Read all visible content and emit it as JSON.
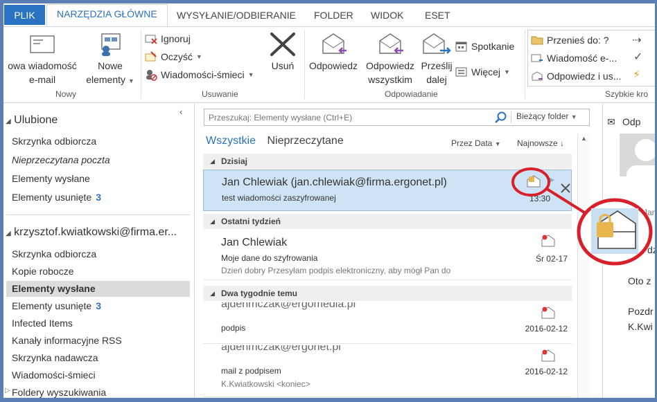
{
  "tabs": {
    "file": "PLIK",
    "home": "NARZĘDZIA GŁÓWNE",
    "send": "WYSYŁANIE/ODBIERANIE",
    "folder": "FOLDER",
    "view": "WIDOK",
    "eset": "ESET"
  },
  "ribbon": {
    "new_email": [
      "owa wiadomość",
      "e-mail"
    ],
    "new_items": [
      "Nowe",
      "elementy"
    ],
    "group_new": "Nowy",
    "ignore": "Ignoruj",
    "clean": "Oczyść",
    "junk": "Wiadomości-śmieci",
    "delete": "Usuń",
    "group_delete": "Usuwanie",
    "reply": "Odpowiedz",
    "reply_all": [
      "Odpowiedz",
      "wszystkim"
    ],
    "forward": [
      "Prześlij",
      "dalej"
    ],
    "meeting": "Spotkanie",
    "more": "Więcej",
    "group_respond": "Odpowiadanie",
    "qs_move": "Przenieś do: ?",
    "qs_email": "Wiadomość e-...",
    "qs_reply": "Odpowiedz i us...",
    "group_quick": "Szybkie kro"
  },
  "left": {
    "favorites": "Ulubione",
    "fav_items": [
      "Skrzynka odbiorcza",
      "Nieprzeczytana poczta",
      "Elementy wysłane",
      "Elementy usunięte"
    ],
    "fav_deleted_count": "3",
    "account": "krzysztof.kwiatkowski@firma.er...",
    "acc_items": [
      "Skrzynka odbiorcza",
      "Kopie robocze",
      "Elementy wysłane",
      "Elementy usunięte",
      "Infected Items",
      "Kanały informacyjne RSS",
      "Skrzynka nadawcza",
      "Wiadomości-śmieci",
      "Foldery wyszukiwania"
    ],
    "acc_deleted_count": "3"
  },
  "mid": {
    "search_placeholder": "Przeszukaj: Elementy wysłane (Ctrl+E)",
    "scope": "Bieżący folder",
    "filter_all": "Wszystkie",
    "filter_unread": "Nieprzeczytane",
    "sort_by": "Przez Data",
    "sort_order": "Najnowsze",
    "group_today": "Dzisiaj",
    "group_last_week": "Ostatni tydzień",
    "group_two_weeks": "Dwa tygodnie temu",
    "messages": [
      {
        "from": "Jan Chlewiak (jan.chlewiak@firma.ergonet.pl)",
        "subject": "test wiadomości zaszyfrowanej",
        "preview": "",
        "date": "13:30"
      },
      {
        "from": "Jan Chlewiak",
        "subject": "Moje dane do szyfrowania",
        "preview": "Dzień dobry  Przesyłam podpis elektroniczny, aby mógł Pan do",
        "date": "Śr 02-17"
      },
      {
        "from": "ajdehmczak@ergomedia.pl",
        "subject": "podpis",
        "preview": "",
        "date": "2016-02-12"
      },
      {
        "from": "ajdehmczak@ergonet.pl",
        "subject": "mail z podpisem",
        "preview": "K.Kwiatkowski <koniec>",
        "date": "2016-02-12"
      }
    ]
  },
  "right": {
    "reply": "Odp",
    "text1": "Jan",
    "text2": "dzie",
    "text3": "Oto z",
    "text4": "Pozdr",
    "text5": "K.Kwi"
  },
  "colors": {
    "accent": "#2a72c2",
    "frame": "#5b7fb5",
    "selected_row": "#cfe3f6",
    "annotation": "#d8202a",
    "lock": "#e8b64c"
  }
}
